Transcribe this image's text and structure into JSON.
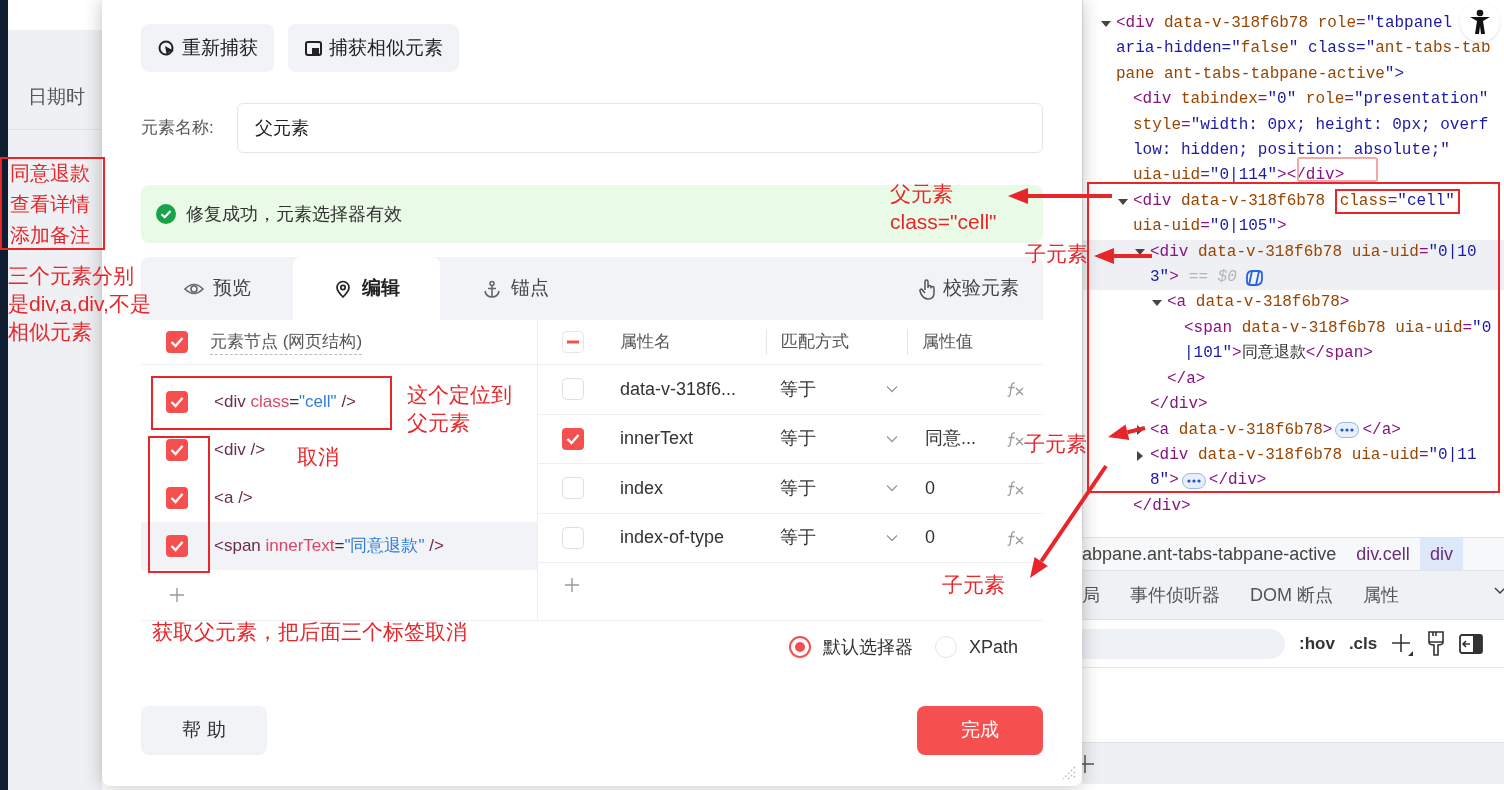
{
  "background_page": {
    "column_header": "日期时",
    "links": [
      "同意退款",
      "查看详情",
      "添加备注"
    ]
  },
  "dialog": {
    "toolbar": [
      {
        "label": "重新捕获",
        "kind": "recapture"
      },
      {
        "label": "捕获相似元素",
        "kind": "similar"
      }
    ],
    "name_field": {
      "label": "元素名称:",
      "value": "父元素"
    },
    "alert": {
      "kind": "success",
      "message": "修复成功，元素选择器有效"
    },
    "tabs": [
      {
        "label": "预览",
        "kind": "eye",
        "selected": false
      },
      {
        "label": "编辑",
        "kind": "pin",
        "selected": true
      },
      {
        "label": "锚点",
        "kind": "anchor",
        "selected": false
      }
    ],
    "validate_button": "校验元素",
    "node_panel": {
      "header": {
        "checked": true,
        "label": "元素节点 (网页结构)"
      },
      "nodes": [
        {
          "code": "<div class=\"cell\" />",
          "checked": true,
          "selected": false
        },
        {
          "code": "<div />",
          "checked": true,
          "selected": false
        },
        {
          "code": "<a />",
          "checked": true,
          "selected": false
        },
        {
          "code": "<span innerText=\"同意退款\" />",
          "checked": true,
          "selected": true
        }
      ]
    },
    "attribute_panel": {
      "select_all": {
        "checked": false,
        "indeterminate": true
      },
      "columns": [
        "属性名",
        "匹配方式",
        "属性值"
      ],
      "rows": [
        {
          "checked": false,
          "name": "data-v-318f6...",
          "match": "等于"
        },
        {
          "checked": true,
          "name": "innerText",
          "match": "等于",
          "value": "同意..."
        },
        {
          "checked": false,
          "name": "index",
          "match": "等于",
          "value": "0"
        },
        {
          "checked": false,
          "name": "index-of-type",
          "match": "等于",
          "value": "0"
        }
      ]
    },
    "selector_mode": [
      {
        "label": "默认选择器",
        "selected": true
      },
      {
        "label": "XPath",
        "selected": false
      }
    ],
    "buttons": [
      {
        "label": "帮 助",
        "kind": "secondary"
      },
      {
        "label": "完成",
        "kind": "primary"
      }
    ]
  },
  "devtools": {
    "dom_tree": [
      {
        "lines": [
          "<div data-v-318f6b78 role=\"tabpanel",
          "aria-hidden=\"false\" class=\"ant-tabs-tab",
          "pane ant-tabs-tabpane-active\">"
        ],
        "expanded": true,
        "selected": false,
        "children": [
          {
            "lines": [
              "<div tabindex=\"0\" role=\"presentation\"",
              "style=\"width: 0px; height: 0px; overf",
              "low: hidden; position: absolute;\"",
              "uia-uid=\"0|114\"></div>"
            ],
            "selected": false
          },
          {
            "lines": [
              "<div data-v-318f6b78 class=\"cell\"",
              "uia-uid=\"0|105\">"
            ],
            "expanded": true,
            "selected": false,
            "close": "</div>",
            "children": [
              {
                "lines": [
                  "<div data-v-318f6b78 uia-uid=\"0|10",
                  "3\">"
                ],
                "expanded": true,
                "selected": true,
                "suffix": "== $0",
                "close": "</div>",
                "children": [
                  {
                    "lines": [
                      "<a data-v-318f6b78>"
                    ],
                    "expanded": true,
                    "selected": false,
                    "close": "</a>",
                    "children": [
                      {
                        "lines": [
                          "<span data-v-318f6b78 uia-uid=\"0",
                          "|101\">同意退款</span>"
                        ],
                        "selected": false
                      }
                    ]
                  }
                ]
              },
              {
                "lines": [
                  "<a data-v-318f6b78>"
                ],
                "expanded": false,
                "selected": false,
                "tail": "</a>"
              },
              {
                "lines": [
                  "<div data-v-318f6b78 uia-uid=\"0|11",
                  "8\">"
                ],
                "expanded": false,
                "selected": false,
                "tail": "</div>"
              }
            ]
          }
        ]
      }
    ],
    "breadcrumbs": [
      {
        "label": "abpane.ant-tabs-tabpane-active",
        "selected": false
      },
      {
        "label": "div.cell",
        "selected": false
      },
      {
        "label": "div",
        "selected": true
      }
    ],
    "panel_tabs": [
      "局",
      "事件侦听器",
      "DOM 断点",
      "属性"
    ],
    "style_toolbar": [
      ":hov",
      ".cls"
    ]
  },
  "annotations": [
    "三个元素分别是div,a,div,不是相似元素",
    "这个定位到父元素",
    "取消",
    "获取父元素，把后面三个标签取消",
    "父元素class=\"cell\"",
    "子元素",
    "子元素",
    "子元素"
  ]
}
